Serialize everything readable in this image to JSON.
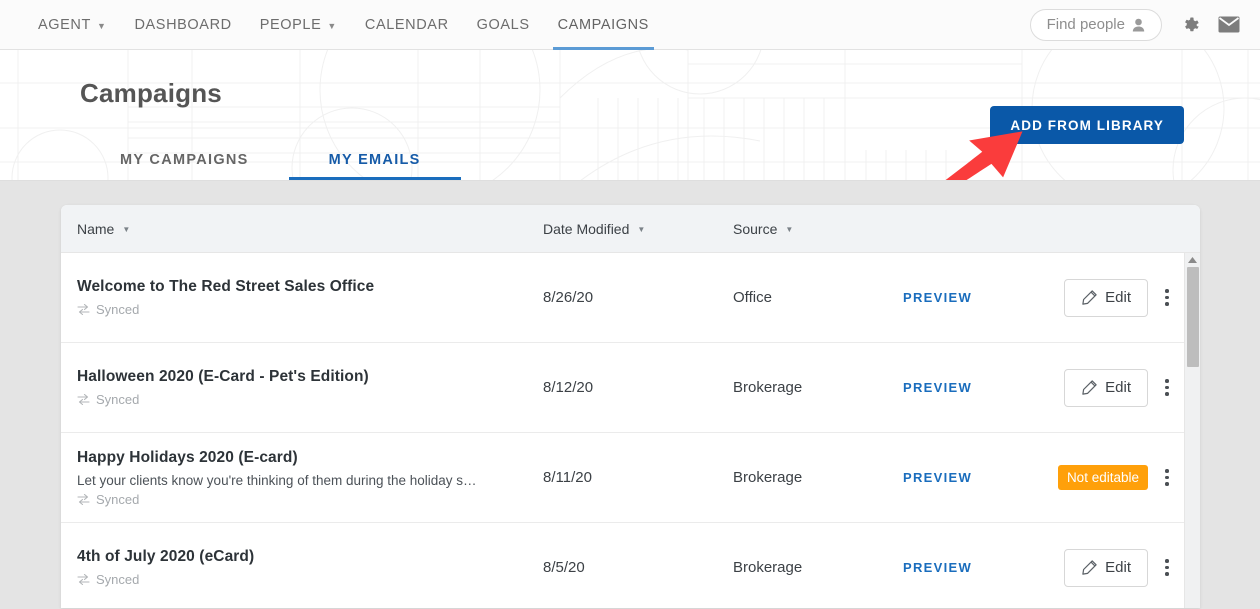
{
  "nav": {
    "items": [
      {
        "label": "AGENT",
        "caret": true,
        "active": false,
        "name": "nav-item-agent"
      },
      {
        "label": "DASHBOARD",
        "caret": false,
        "active": false,
        "name": "nav-item-dashboard"
      },
      {
        "label": "PEOPLE",
        "caret": true,
        "active": false,
        "name": "nav-item-people"
      },
      {
        "label": "CALENDAR",
        "caret": false,
        "active": false,
        "name": "nav-item-calendar"
      },
      {
        "label": "GOALS",
        "caret": false,
        "active": false,
        "name": "nav-item-goals"
      },
      {
        "label": "CAMPAIGNS",
        "caret": false,
        "active": true,
        "name": "nav-item-campaigns"
      }
    ],
    "search": {
      "label": "Find people",
      "icon": "person-icon"
    },
    "settings_icon": "gear-icon",
    "messages_icon": "envelope-icon"
  },
  "hero": {
    "title": "Campaigns",
    "tabs": [
      {
        "label": "MY CAMPAIGNS",
        "active": false,
        "name": "tab-my-campaigns"
      },
      {
        "label": "MY EMAILS",
        "active": true,
        "name": "tab-my-emails"
      }
    ],
    "primary_button": "ADD FROM LIBRARY",
    "annotation": {
      "type": "red-arrow",
      "color": "#fa3c3c",
      "points_to": "ADD FROM LIBRARY"
    }
  },
  "table": {
    "columns": [
      {
        "label": "Name",
        "sortable": true,
        "name": "column-header-name"
      },
      {
        "label": "Date Modified",
        "sortable": true,
        "name": "column-header-date-modified"
      },
      {
        "label": "Source",
        "sortable": true,
        "name": "column-header-source"
      }
    ],
    "preview_label": "PREVIEW",
    "edit_label": "Edit",
    "not_editable_label": "Not editable",
    "sync_label": "Synced",
    "rows": [
      {
        "title": "Welcome to The Red Street Sales Office",
        "description": "",
        "sync": "Synced",
        "date": "8/26/20",
        "source": "Office",
        "action": "edit"
      },
      {
        "title": "Halloween 2020 (E-Card - Pet's Edition)",
        "description": "",
        "sync": "Synced",
        "date": "8/12/20",
        "source": "Brokerage",
        "action": "edit"
      },
      {
        "title": "Happy Holidays 2020 (E-card)",
        "description": "Let your clients know you're thinking of them during the holiday s…",
        "sync": "Synced",
        "date": "8/11/20",
        "source": "Brokerage",
        "action": "not-editable"
      },
      {
        "title": "4th of July 2020 (eCard)",
        "description": "",
        "sync": "Synced",
        "date": "8/5/20",
        "source": "Brokerage",
        "action": "edit"
      }
    ]
  },
  "colors": {
    "primary_blue": "#0a58a8",
    "link_blue": "#1a6dbd",
    "nav_underline": "#5b9bd5",
    "warning_orange": "#ffa00a",
    "annotation_red": "#fa3c3c",
    "page_bg": "#e4e4e4"
  }
}
